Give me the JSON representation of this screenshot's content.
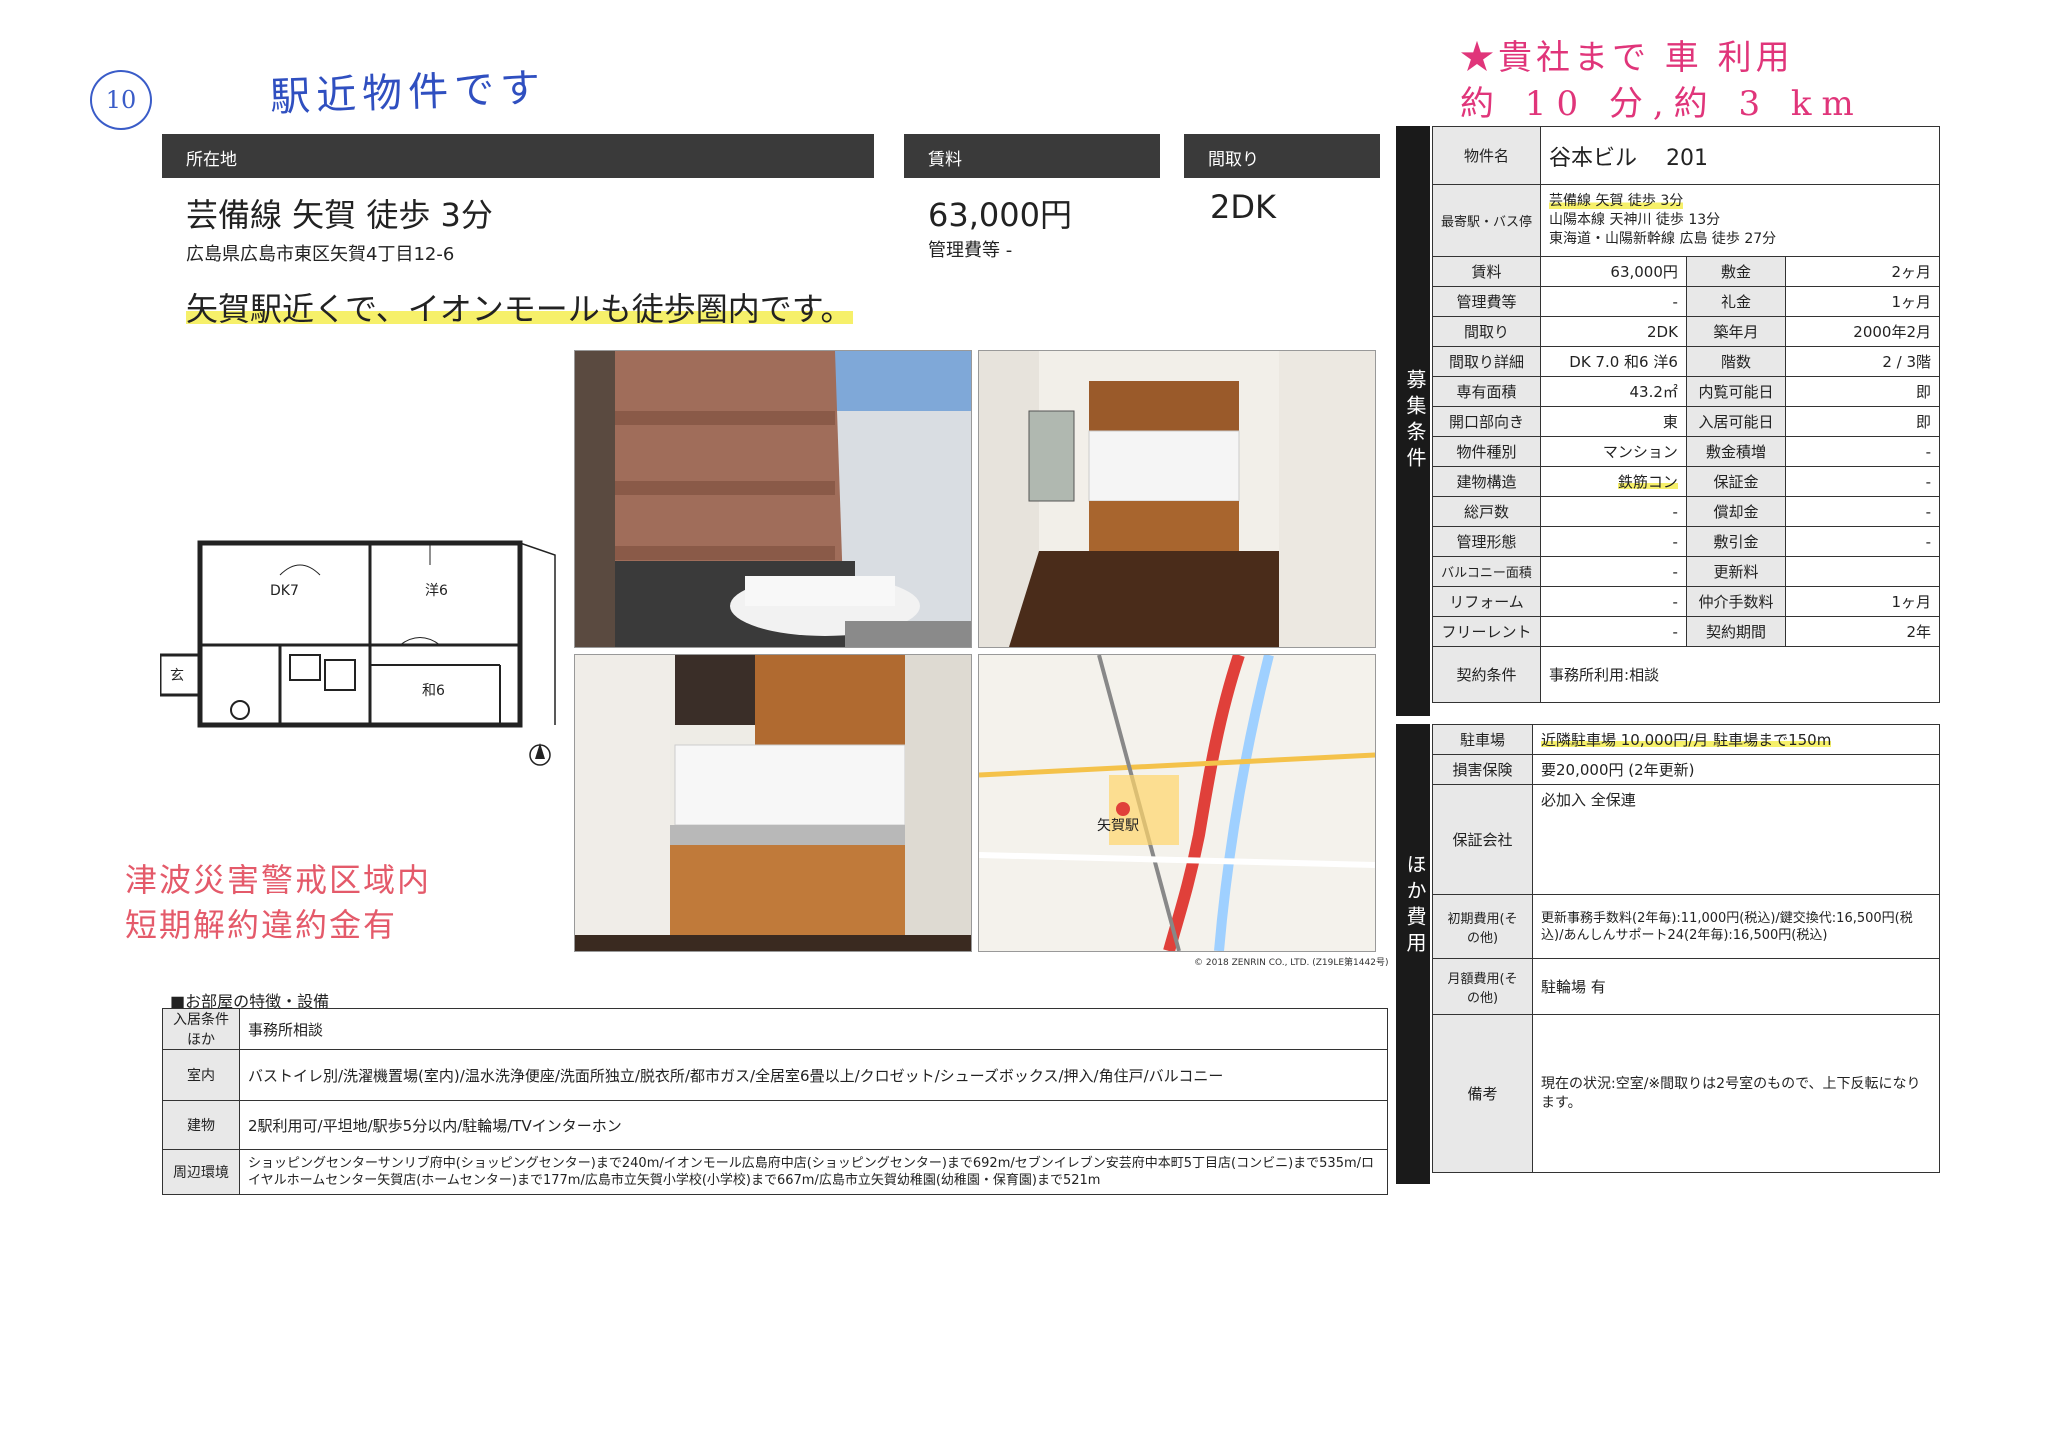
{
  "handwritten": {
    "circle_number": "10",
    "note_top_left": "駅近物件です",
    "note_top_right_line1": "★貴社まで 車 利用",
    "note_top_right_line2": "約 10 分,約 3 km",
    "warning_line1": "津波災害警戒区域内",
    "warning_line2": "短期解約違約金有"
  },
  "header": {
    "location_label": "所在地",
    "rent_label": "賃料",
    "layout_label": "間取り"
  },
  "summary": {
    "station": "芸備線 矢賀 徒歩 3分",
    "address": "広島県広島市東区矢賀4丁目12-6",
    "rent": "63,000円",
    "management_fee": "管理費等 -",
    "layout": "2DK",
    "catchphrase": "矢賀駅近くで、イオンモールも徒歩圏内です。"
  },
  "floorplan": {
    "room_dk": "DK7",
    "room_western": "洋6",
    "room_japanese": "和6",
    "entrance": "玄"
  },
  "map": {
    "station_label": "矢賀駅",
    "copyright": "© 2018 ZENRIN CO., LTD. (Z19LE第1442号)"
  },
  "features": {
    "section_title": "■お部屋の特徴・設備",
    "rows": [
      {
        "label": "入居条件ほか",
        "value": "事務所相談"
      },
      {
        "label": "室内",
        "value": "バストイレ別/洗濯機置場(室内)/温水洗浄便座/洗面所独立/脱衣所/都市ガス/全居室6畳以上/クロゼット/シューズボックス/押入/角住戸/バルコニー"
      },
      {
        "label": "建物",
        "value": "2駅利用可/平坦地/駅歩5分以内/駐輪場/TVインターホン"
      },
      {
        "label": "周辺環境",
        "value": "ショッピングセンターサンリブ府中(ショッピングセンター)まで240m/イオンモール広島府中店(ショッピングセンター)まで692m/セブンイレブン安芸府中本町5丁目店(コンビニ)まで535m/ロイヤルホームセンター矢賀店(ホームセンター)まで177m/広島市立矢賀小学校(小学校)まで667m/広島市立矢賀幼稚園(幼稚園・保育園)まで521m"
      }
    ]
  },
  "spec": {
    "side_label_recruit": "募集条件",
    "side_label_costs": "ほか費用",
    "property_name_label": "物件名",
    "property_name": "谷本ビル　 201",
    "nearest_label": "最寄駅・バス停",
    "nearest": [
      "芸備線 矢賀 徒歩 3分",
      "山陽本線 天神川 徒歩 13分",
      "東海道・山陽新幹線 広島 徒歩 27分"
    ],
    "rows": [
      {
        "l1": "賃料",
        "v1": "63,000円",
        "l2": "敷金",
        "v2": "2ヶ月"
      },
      {
        "l1": "管理費等",
        "v1": "-",
        "l2": "礼金",
        "v2": "1ヶ月"
      },
      {
        "l1": "間取り",
        "v1": "2DK",
        "l2": "築年月",
        "v2": "2000年2月"
      },
      {
        "l1": "間取り詳細",
        "v1": "DK 7.0 和6 洋6",
        "l2": "階数",
        "v2": "2 / 3階"
      },
      {
        "l1": "専有面積",
        "v1": "43.2㎡",
        "l2": "内覧可能日",
        "v2": "即"
      },
      {
        "l1": "開口部向き",
        "v1": "東",
        "l2": "入居可能日",
        "v2": "即"
      },
      {
        "l1": "物件種別",
        "v1": "マンション",
        "l2": "敷金積増",
        "v2": "-"
      },
      {
        "l1": "建物構造",
        "v1": "鉄筋コン",
        "l2": "保証金",
        "v2": "-"
      },
      {
        "l1": "総戸数",
        "v1": "-",
        "l2": "償却金",
        "v2": "-"
      },
      {
        "l1": "管理形態",
        "v1": "-",
        "l2": "敷引金",
        "v2": "-"
      },
      {
        "l1": "バルコニー面積",
        "v1": "-",
        "l2": "更新料",
        "v2": ""
      },
      {
        "l1": "リフォーム",
        "v1": "-",
        "l2": "仲介手数料",
        "v2": "1ヶ月"
      },
      {
        "l1": "フリーレント",
        "v1": "-",
        "l2": "契約期間",
        "v2": "2年"
      }
    ],
    "contract_label": "契約条件",
    "contract_value": "事務所利用:相談"
  },
  "other": {
    "parking_label": "駐車場",
    "parking_value": "近隣駐車場 10,000円/月 駐車場まで150m",
    "insurance_label": "損害保険",
    "insurance_value": "要20,000円 (2年更新)",
    "guarantor_label": "保証会社",
    "guarantor_value": "必加入 全保連",
    "initial_label": "初期費用(その他)",
    "initial_value": "更新事務手数料(2年毎):11,000円(税込)/鍵交換代:16,500円(税込)/あんしんサポート24(2年毎):16,500円(税込)",
    "monthly_label": "月額費用(その他)",
    "monthly_value": "駐輪場 有",
    "remarks_label": "備考",
    "remarks_value": "現在の状況:空室/※間取りは2号室のもので、上下反転になります。"
  }
}
